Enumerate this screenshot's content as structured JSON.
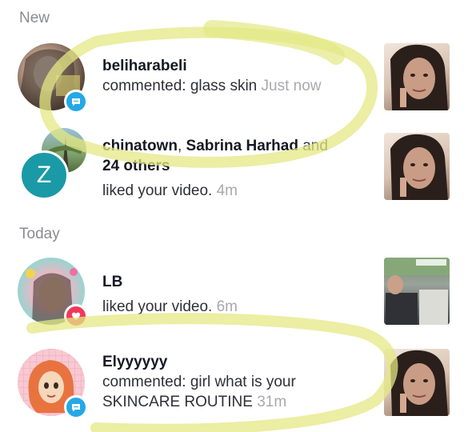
{
  "sections": {
    "new": {
      "label": "New"
    },
    "today": {
      "label": "Today"
    }
  },
  "notifications": [
    {
      "username": "beliharabeli",
      "action": "commented: glass skin",
      "time": "Just now",
      "badge": "comment-icon"
    },
    {
      "user_a": "chinatown",
      "separator": ", ",
      "user_b": "Sabrina Harhad",
      "connector": " and",
      "others": "24 others",
      "action": "liked your video.",
      "time": "4m",
      "avatar_letter": "Z"
    },
    {
      "username": "LB",
      "action": "liked your video.",
      "time": "6m",
      "badge": "heart-icon"
    },
    {
      "username": "Elyyyyyy",
      "action": "commented: girl what is your",
      "action2": "SKINCARE ROUTINE",
      "time": "31m",
      "badge": "comment-icon"
    }
  ],
  "colors": {
    "highlight": "#e8ec8c",
    "comment_badge": "#25a8e6",
    "like_badge": "#f0385a",
    "z_avatar": "#1a9aa6",
    "muted": "#8a8b91"
  }
}
